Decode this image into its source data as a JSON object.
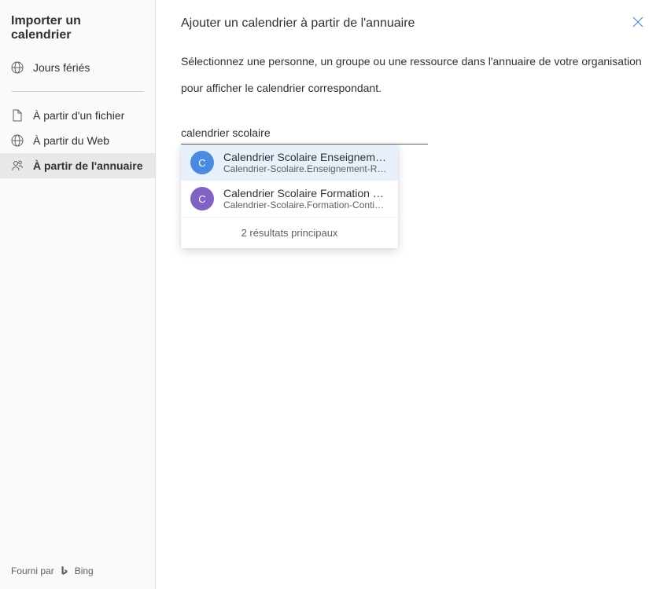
{
  "sidebar": {
    "title": "Importer un calendrier",
    "holidays": "Jours fériés",
    "items": [
      {
        "label": "À partir d'un fichier"
      },
      {
        "label": "À partir du Web"
      },
      {
        "label": "À partir de l'annuaire"
      }
    ]
  },
  "footer": {
    "powered_by": "Fourni par",
    "provider": "Bing"
  },
  "main": {
    "title": "Ajouter un calendrier à partir de l'annuaire",
    "description": "Sélectionnez une personne, un groupe ou une ressource dans l'annuaire de votre organisation pour afficher le calendrier correspondant.",
    "input_value": "calendrier scolaire"
  },
  "dropdown": {
    "items": [
      {
        "initial": "C",
        "name": "Calendrier Scolaire Enseignement Reg…",
        "email": "Calendrier-Scolaire.Enseignement-Regulier…",
        "color": "blue",
        "selected": true
      },
      {
        "initial": "C",
        "name": "Calendrier Scolaire Formation Continue",
        "email": "Calendrier-Scolaire.Formation-Continue@co…",
        "color": "purple",
        "selected": false
      }
    ],
    "footer": "2 résultats principaux"
  }
}
